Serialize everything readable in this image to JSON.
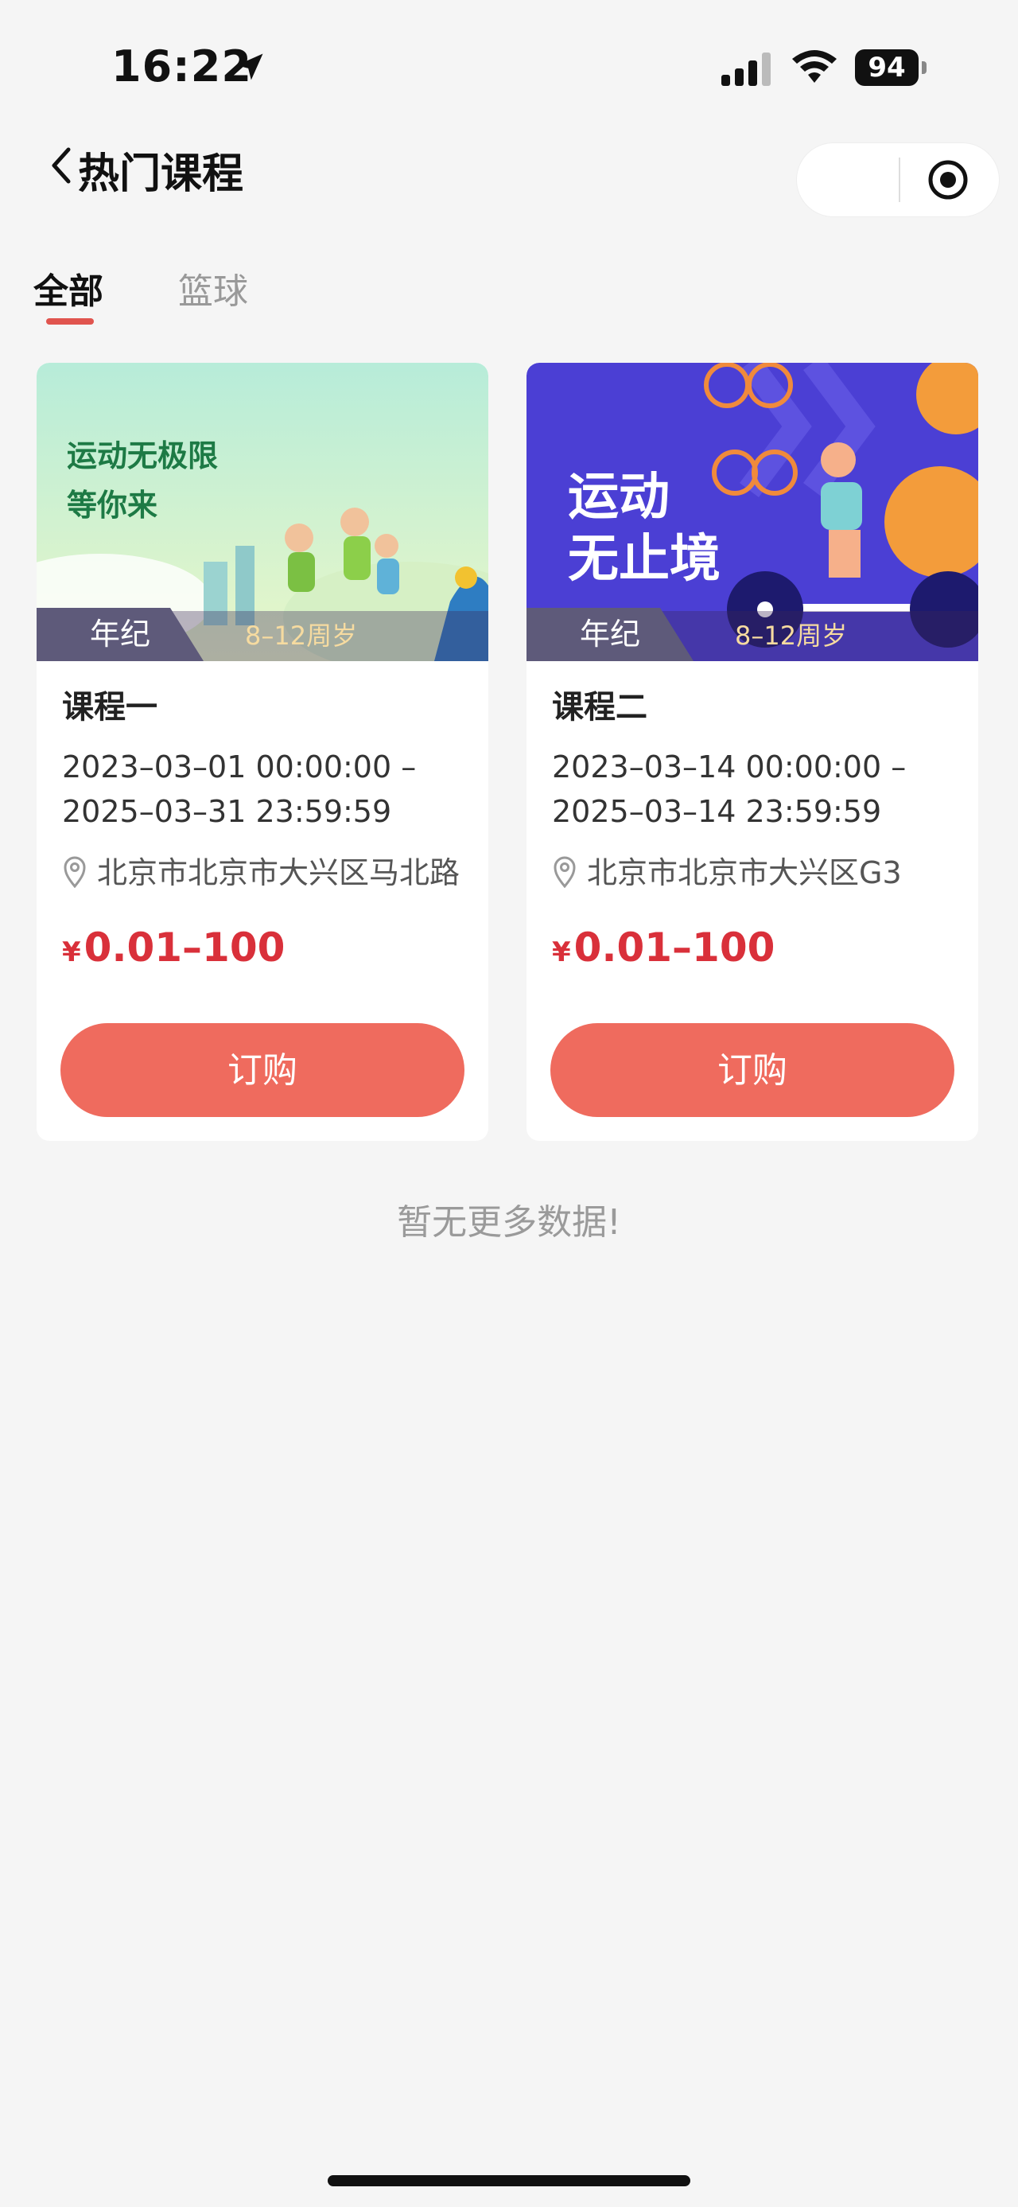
{
  "status_bar": {
    "time": "16:22",
    "battery": "94"
  },
  "nav": {
    "title": "热门课程"
  },
  "tabs": [
    {
      "label": "全部",
      "active": true
    },
    {
      "label": "篮球",
      "active": false
    }
  ],
  "courses": [
    {
      "banner_text": "运动无极限\n等你来",
      "age_tag": "年纪",
      "age_range": "8–12周岁",
      "name": "课程一",
      "time_range": "2023–03–01 00:00:00 –\n2025–03–31 23:59:59",
      "address": "北京市北京市大兴区马北路",
      "currency": "¥",
      "price": "0.01–100",
      "button": "订购"
    },
    {
      "banner_text": "运动\n无止境",
      "age_tag": "年纪",
      "age_range": "8–12周岁",
      "name": "课程二",
      "time_range": "2023–03–14 00:00:00 –\n2025–03–14 23:59:59",
      "address": "北京市北京市大兴区G3",
      "currency": "¥",
      "price": "0.01–100",
      "button": "订购"
    }
  ],
  "footer": {
    "no_more": "暂无更多数据!"
  },
  "colors": {
    "accent": "#ef6b5e",
    "price": "#d9303a",
    "tab_underline": "#e0544e"
  }
}
